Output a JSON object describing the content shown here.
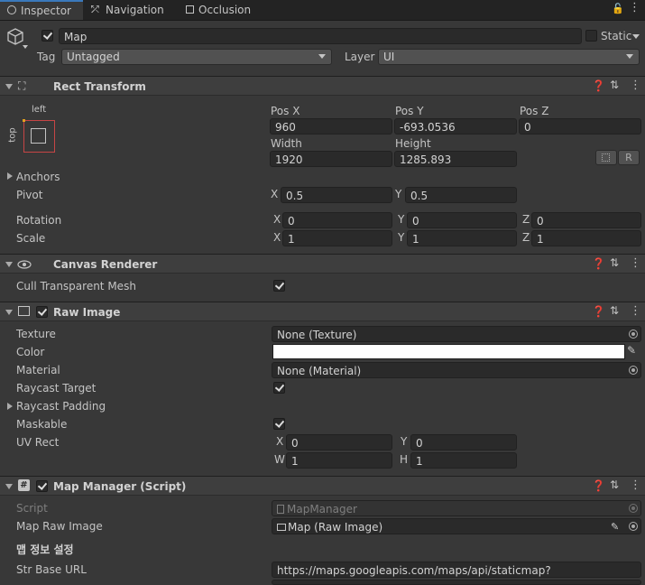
{
  "tabs": [
    {
      "label": "Inspector",
      "icon": "info-icon"
    },
    {
      "label": "Navigation",
      "icon": "navigation-icon"
    },
    {
      "label": "Occlusion",
      "icon": "occlusion-icon"
    }
  ],
  "object": {
    "name": "Map",
    "static_label": "Static",
    "tag_label": "Tag",
    "tag_value": "Untagged",
    "layer_label": "Layer",
    "layer_value": "UI",
    "active": true
  },
  "rect_transform": {
    "title": "Rect Transform",
    "anchor_h": "left",
    "anchor_v": "top",
    "pos_x_label": "Pos X",
    "pos_x": "960",
    "pos_y_label": "Pos Y",
    "pos_y": "-693.0536",
    "pos_z_label": "Pos Z",
    "pos_z": "0",
    "width_label": "Width",
    "width": "1920",
    "height_label": "Height",
    "height": "1285.893",
    "r_button": "R",
    "anchors_label": "Anchors",
    "pivot_label": "Pivot",
    "pivot_x": "0.5",
    "pivot_y": "0.5",
    "rotation_label": "Rotation",
    "rot_x": "0",
    "rot_y": "0",
    "rot_z": "0",
    "scale_label": "Scale",
    "scale_x": "1",
    "scale_y": "1",
    "scale_z": "1",
    "x": "X",
    "y": "Y",
    "z": "Z"
  },
  "canvas_renderer": {
    "title": "Canvas Renderer",
    "cull_label": "Cull Transparent Mesh",
    "cull_checked": true
  },
  "raw_image": {
    "title": "Raw Image",
    "texture_label": "Texture",
    "texture_value": "None (Texture)",
    "color_label": "Color",
    "color_value": "#ffffff",
    "material_label": "Material",
    "material_value": "None (Material)",
    "raycast_target_label": "Raycast Target",
    "raycast_padding_label": "Raycast Padding",
    "maskable_label": "Maskable",
    "uv_rect_label": "UV Rect",
    "uv_x": "0",
    "uv_y": "0",
    "uv_w": "1",
    "uv_h": "1",
    "x": "X",
    "y": "Y",
    "w": "W",
    "h": "H"
  },
  "map_manager": {
    "title": "Map Manager (Script)",
    "script_label": "Script",
    "script_value": "MapManager",
    "map_raw_image_label": "Map Raw Image",
    "map_raw_image_value": "Map (Raw Image)",
    "section_header": "맵 정보 설정",
    "str_base_url_label": "Str Base URL",
    "str_base_url_value": "https://maps.googleapis.com/maps/api/staticmap?"
  },
  "colors": {
    "accent": "#3a79bb",
    "background": "#383838",
    "header": "#3e3e3e",
    "field": "#2a2a2a",
    "anchor_red": "#c64545"
  }
}
